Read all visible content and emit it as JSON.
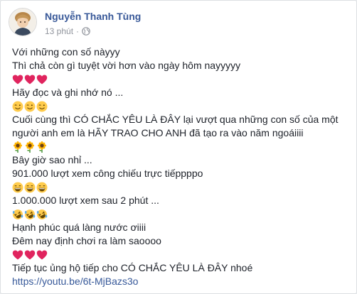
{
  "post": {
    "author": "Nguyễn Thanh Tùng",
    "time": "13 phút",
    "separator": "·",
    "privacy_icon": "globe-icon",
    "avatar_icon": "avatar-icon"
  },
  "content": {
    "line1": "Với những con số nàyyy",
    "line2": "Thì chả còn gì tuyệt vời hơn vào ngày hôm nayyyyy",
    "emoji_row1": [
      "heart",
      "heart",
      "heart"
    ],
    "line3": "Hãy đọc và ghi nhớ nó ...",
    "emoji_row2": [
      "wink",
      "wink",
      "wink"
    ],
    "line4": "Cuối cùng thì CÓ CHẮC YÊU LÀ ĐÂY lại vượt qua những con số của một",
    "line5": "người anh em là HÃY TRAO CHO ANH đã tạo ra vào năm ngoáiiii",
    "emoji_row3": [
      "sunflower",
      "sunflower",
      "sunflower"
    ],
    "line6": "Bây giờ sao nhỉ ...",
    "line7": "901.000 lượt xem công chiếu trực tiếppppo",
    "emoji_row4": [
      "grin",
      "grin",
      "grin"
    ],
    "line8": "1.000.000 lượt xem sau 2 phút ...",
    "emoji_row5": [
      "rofl",
      "rofl",
      "rofl"
    ],
    "line9": "Hạnh phúc quá làng nước ơiiii",
    "line10": "Đêm nay định chơi ra làm saoooo",
    "emoji_row6": [
      "heart",
      "heart",
      "heart"
    ],
    "line11": "Tiếp tục ủng hộ tiếp cho CÓ CHẮC YÊU LÀ ĐÂY nhoé",
    "link": "https://youtu.be/6t-MjBazs3o"
  },
  "colors": {
    "author_link": "#385898",
    "link": "#365899",
    "text": "#1d2129",
    "meta": "#90949c",
    "heart": "#e0245e",
    "emoji_yellow": "#ffcc4d"
  }
}
